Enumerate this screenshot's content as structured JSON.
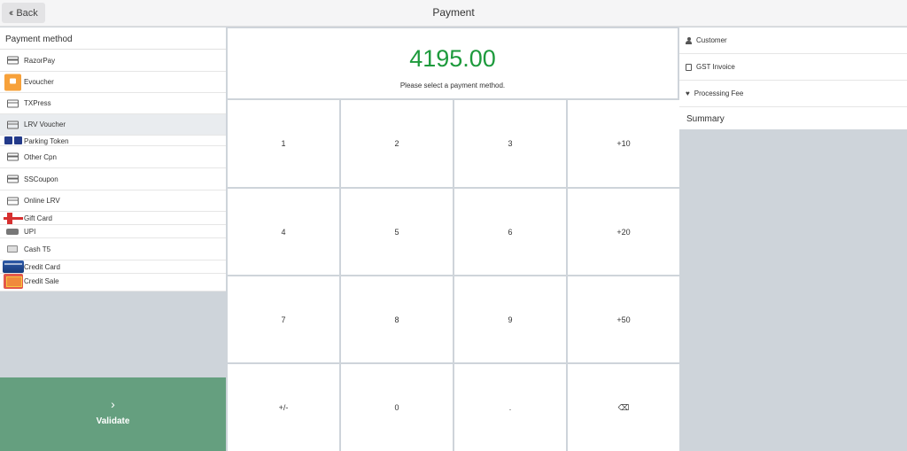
{
  "header": {
    "back_label": "Back",
    "back_icon": "double-chevron-left-icon",
    "title": "Payment"
  },
  "left": {
    "heading": "Payment method",
    "methods": [
      {
        "label": "RazorPay",
        "icon": "card-icon"
      },
      {
        "label": "Evoucher",
        "icon": "evoucher-icon"
      },
      {
        "label": "TXPress",
        "icon": "card-icon"
      },
      {
        "label": "LRV Voucher",
        "icon": "card-icon",
        "selected": true
      },
      {
        "label": "Parking Token",
        "icon": "parking-icon"
      },
      {
        "label": "Other Cpn",
        "icon": "card-icon"
      },
      {
        "label": "SSCoupon",
        "icon": "card-icon"
      },
      {
        "label": "Online LRV",
        "icon": "card-icon"
      },
      {
        "label": "Gift Card",
        "icon": "gift-icon"
      },
      {
        "label": "UPI",
        "icon": "upi-icon"
      },
      {
        "label": "Cash T5",
        "icon": "cash-icon"
      },
      {
        "label": "Credit Card",
        "icon": "credit-card-icon"
      },
      {
        "label": "Credit Sale",
        "icon": "credit-sale-icon"
      }
    ],
    "validate_label": "Validate"
  },
  "center": {
    "amount": "4195.00",
    "message": "Please select a payment method.",
    "amount_color": "#1d9a3c",
    "keys": [
      "1",
      "2",
      "3",
      "+10",
      "4",
      "5",
      "6",
      "+20",
      "7",
      "8",
      "9",
      "+50",
      "+/-",
      "0",
      ".",
      "⌫"
    ]
  },
  "right": {
    "customer_label": "Customer",
    "gst_label": "GST Invoice",
    "fee_label": "Processing Fee",
    "summary_label": "Summary"
  },
  "colors": {
    "validate_bg": "#659f7f",
    "background": "#ced4da"
  }
}
